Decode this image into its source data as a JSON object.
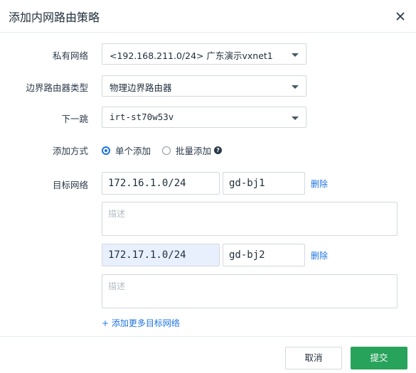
{
  "dialog": {
    "title": "添加内网路由策略"
  },
  "form": {
    "private_network": {
      "label": "私有网络",
      "value": "<192.168.211.0/24> 广东演示vxnet1"
    },
    "border_router_type": {
      "label": "边界路由器类型",
      "value": "物理边界路由器"
    },
    "next_hop": {
      "label": "下一跳",
      "value": "irt-st70w53v"
    },
    "add_method": {
      "label": "添加方式",
      "options": [
        "单个添加",
        "批量添加"
      ],
      "selected": "单个添加"
    },
    "targets": {
      "label": "目标网络",
      "delete_label": "删除",
      "desc_placeholder": "描述",
      "rows": [
        {
          "cidr": "172.16.1.0/24",
          "name": "gd-bj1",
          "desc": ""
        },
        {
          "cidr": "172.17.1.0/24",
          "name": "gd-bj2",
          "desc": ""
        }
      ],
      "add_more_label": "+ 添加更多目标网络"
    }
  },
  "footer": {
    "cancel_label": "取消",
    "submit_label": "提交"
  },
  "colors": {
    "accent": "#1f74e0",
    "primary_button": "#27a35b",
    "highlight_input": "#e8f0fd"
  }
}
